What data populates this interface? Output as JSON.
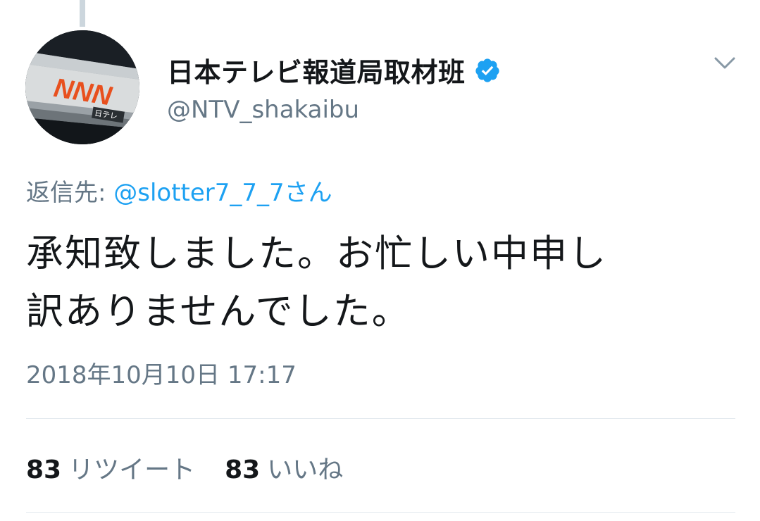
{
  "tweet": {
    "author": {
      "display_name": "日本テレビ報道局取材班",
      "handle": "@NTV_shakaibu",
      "verified": true,
      "avatar_text": "NNN",
      "avatar_sign": "日テレ"
    },
    "reply_to": {
      "prefix": "返信先: ",
      "mention": "@slotter7_7_7さん"
    },
    "text_line_1": "承知致しました。お忙しい中申し",
    "text_line_2": "訳ありませんでした。",
    "timestamp": "2018年10月10日 17:17",
    "stats": {
      "retweets_count": "83",
      "retweets_label": "リツイート",
      "likes_count": "83",
      "likes_label": "いいね"
    }
  },
  "colors": {
    "text_primary": "#14171a",
    "text_secondary": "#657786",
    "link": "#1da1f2",
    "verified": "#1da1f2",
    "divider": "#e1e8ed",
    "avatar_logo": "#e8501e"
  },
  "icons": {
    "verified": "verified-badge-icon",
    "menu": "chevron-down-icon"
  }
}
